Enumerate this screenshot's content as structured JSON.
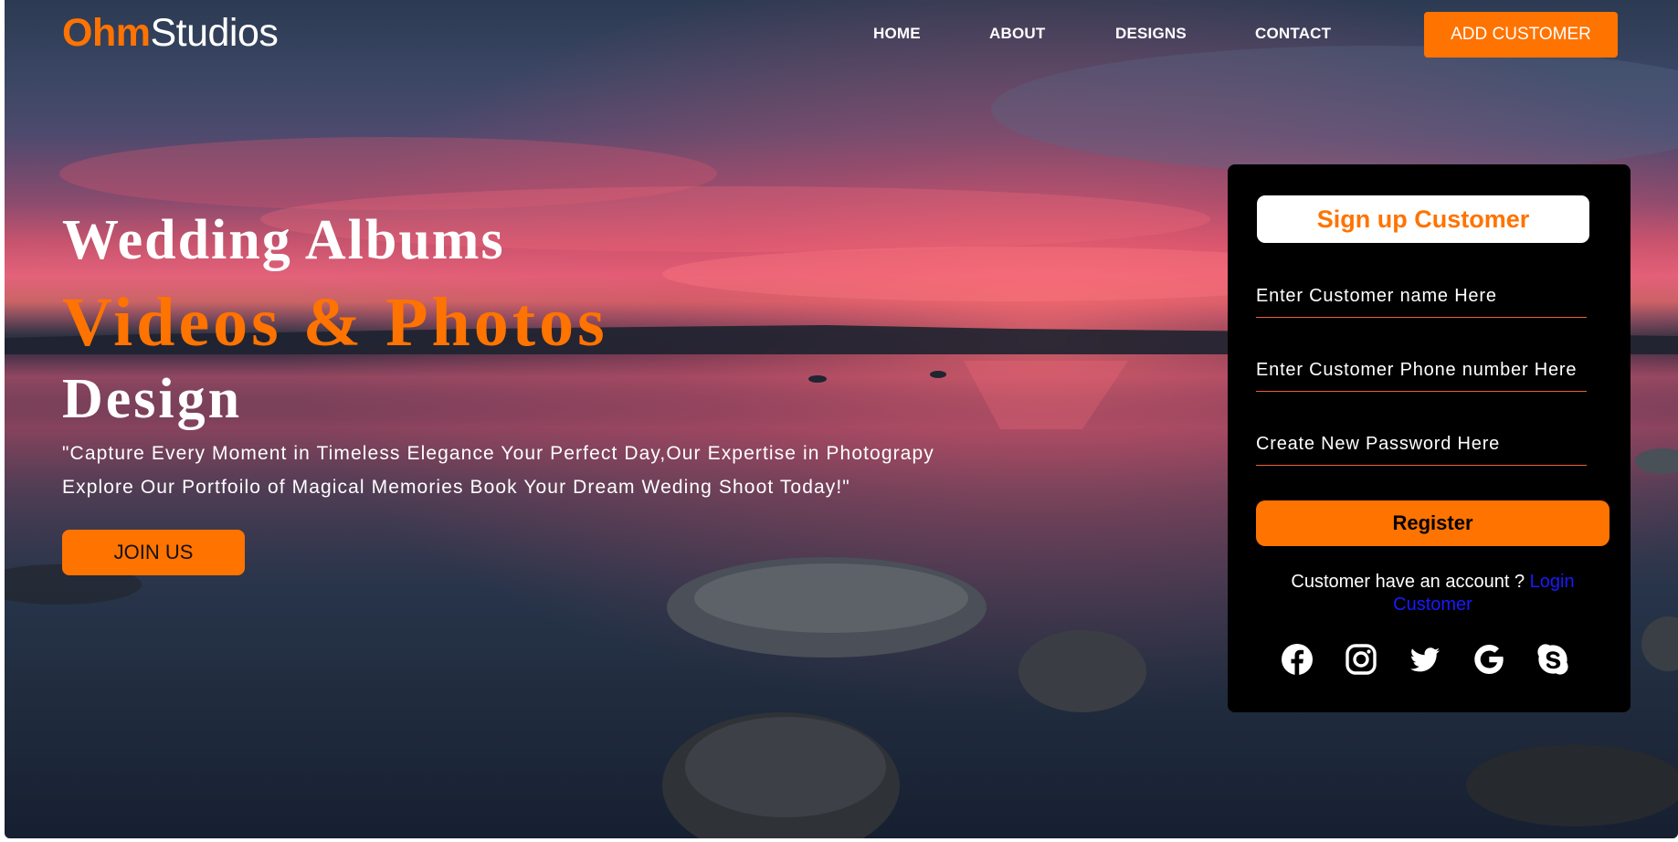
{
  "brand": {
    "logo_accent": "Ohm",
    "logo_rest": "Studios",
    "accent_color": "#ff7300"
  },
  "nav": {
    "items": [
      "HOME",
      "ABOUT",
      "DESIGNS",
      "CONTACT"
    ],
    "add_customer_label": "ADD CUSTOMER"
  },
  "hero": {
    "line1": "Wedding Albums",
    "line2": "Videos & Photos",
    "line3": "Design",
    "quote_line1": "\"Capture Every Moment in Timeless Elegance Your Perfect Day,Our Expertise in Photograpy",
    "quote_line2": "Explore Our Portfoilo of Magical Memories Book Your Dream Weding Shoot Today!\"",
    "join_label": "JOIN US"
  },
  "signup": {
    "title": "Sign up Customer",
    "name_placeholder": "Enter Customer name Here",
    "phone_placeholder": "Enter Customer Phone number Here",
    "password_placeholder": "Create New Password Here",
    "register_label": "Register",
    "have_account_text": "Customer have an account ?",
    "login_link_text": "Login Customer",
    "social_icons": [
      "facebook-icon",
      "instagram-icon",
      "twitter-icon",
      "google-icon",
      "skype-icon"
    ]
  }
}
